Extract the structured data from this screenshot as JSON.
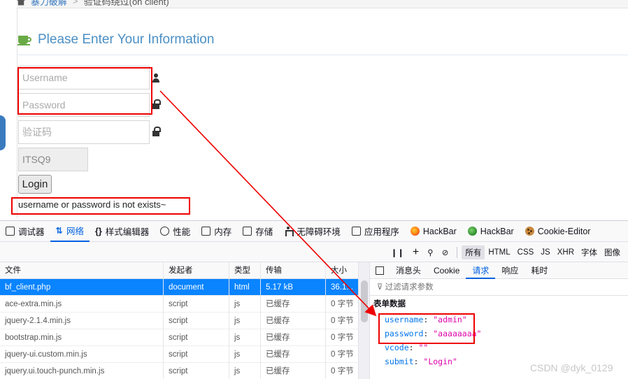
{
  "breadcrumb": {
    "home": "暴力破解",
    "current": "验证码绕过(on client)"
  },
  "heading": "Please Enter Your Information",
  "form": {
    "username_placeholder": "Username",
    "password_placeholder": "Password",
    "vcode_placeholder": "验证码",
    "captcha": "ITSQ9",
    "login_label": "Login",
    "message": "username or password is not exists~"
  },
  "devtools": {
    "tabs": [
      "调试器",
      "网络",
      "样式编辑器",
      "性能",
      "内存",
      "存储",
      "无障碍环境",
      "应用程序",
      "HackBar",
      "HackBar",
      "Cookie-Editor"
    ],
    "filters": [
      "所有",
      "HTML",
      "CSS",
      "JS",
      "XHR",
      "字体",
      "图像"
    ],
    "columns": [
      "文件",
      "发起者",
      "类型",
      "传输",
      "大小"
    ],
    "rows": [
      {
        "file": "bf_client.php",
        "initiator": "document",
        "type": "html",
        "transfer": "5.17 kB",
        "size": "36.1..."
      },
      {
        "file": "ace-extra.min.js",
        "initiator": "script",
        "type": "js",
        "transfer": "已缓存",
        "size": "0 字节"
      },
      {
        "file": "jquery-2.1.4.min.js",
        "initiator": "script",
        "type": "js",
        "transfer": "已缓存",
        "size": "0 字节"
      },
      {
        "file": "bootstrap.min.js",
        "initiator": "script",
        "type": "js",
        "transfer": "已缓存",
        "size": "0 字节"
      },
      {
        "file": "jquery-ui.custom.min.js",
        "initiator": "script",
        "type": "js",
        "transfer": "已缓存",
        "size": "0 字节"
      },
      {
        "file": "jquery.ui.touch-punch.min.js",
        "initiator": "script",
        "type": "js",
        "transfer": "已缓存",
        "size": "0 字节"
      }
    ],
    "detail_tabs": [
      "消息头",
      "Cookie",
      "请求",
      "响应",
      "耗时"
    ],
    "filter_placeholder": "过滤请求参数",
    "section": "表单数据",
    "form_data": [
      {
        "k": "username",
        "v": "\"admin\""
      },
      {
        "k": "password",
        "v": "\"aaaaaaaa\""
      },
      {
        "k": "vcode",
        "v": "\"\""
      },
      {
        "k": "submit",
        "v": "\"Login\""
      }
    ]
  },
  "watermark": "CSDN @dyk_0129",
  "colors": {
    "accent": "#0a84ff",
    "annotation": "#e00000",
    "heading": "#4b8fc4"
  }
}
